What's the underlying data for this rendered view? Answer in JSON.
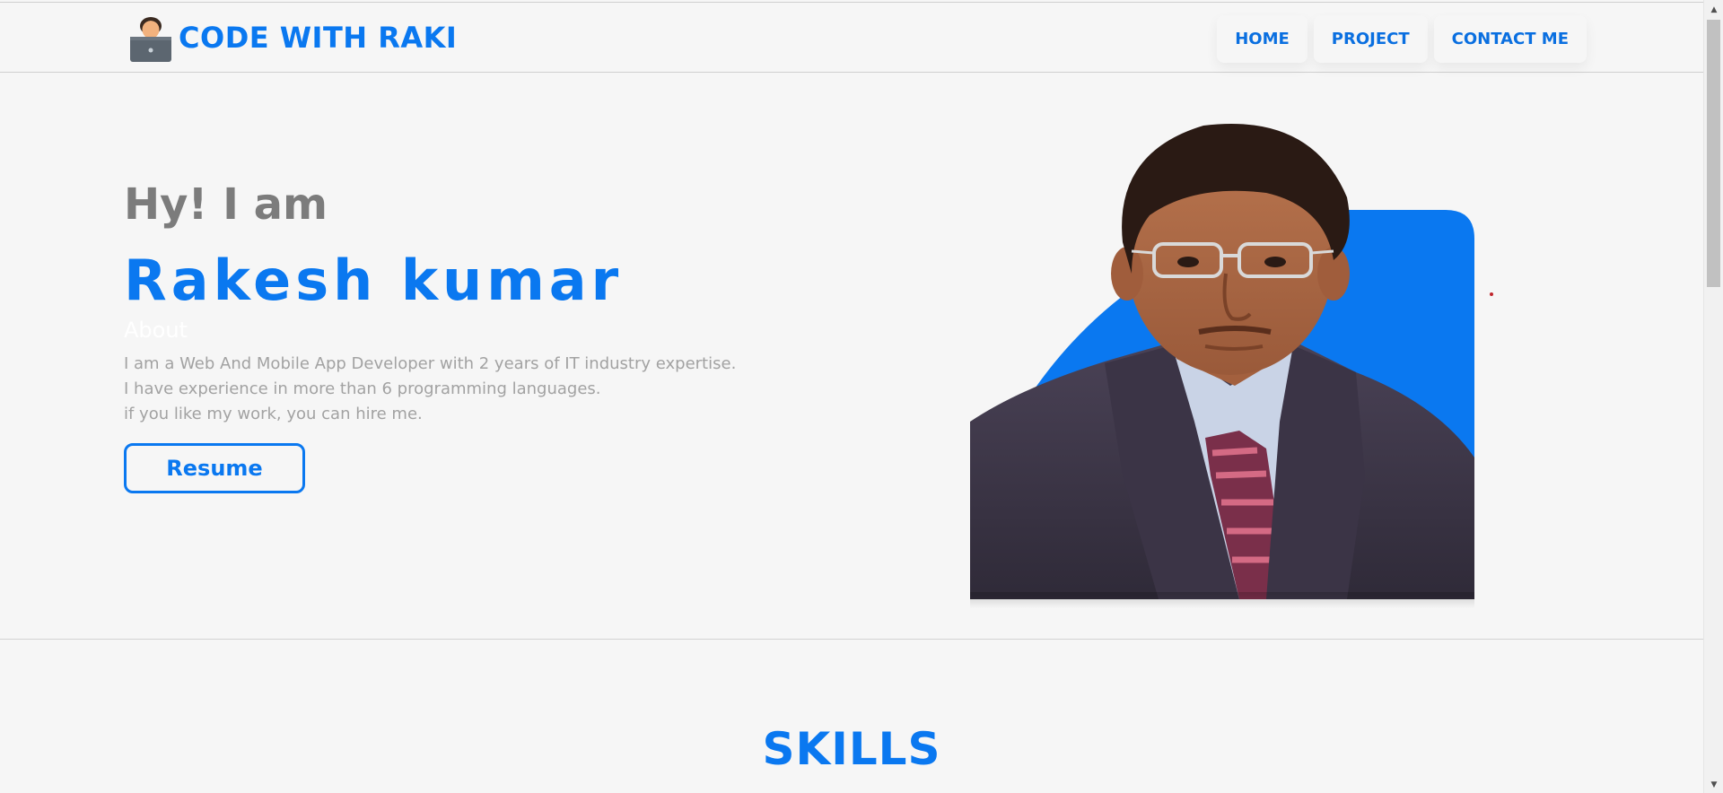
{
  "header": {
    "logo_text": "CODE WITH RAKI",
    "logo_icon": "developer-laptop-icon",
    "nav": [
      {
        "label": "HOME"
      },
      {
        "label": "PROJECT"
      },
      {
        "label": "CONTACT ME"
      }
    ]
  },
  "hero": {
    "greeting": "Hy! I am",
    "name": "Rakesh kumar",
    "about_title": "About",
    "about_lines": [
      "I am a Web And Mobile App Developer with 2 years of IT industry expertise.",
      "I have experience in more than 6 programming languages.",
      "if you like my work, you can hire me."
    ],
    "resume_button": "Resume"
  },
  "skills": {
    "title": "SKILLS"
  },
  "colors": {
    "accent": "#0a78f0",
    "background": "#f6f6f6",
    "greeting": "#7c7c7c",
    "body_text": "#a2a2a2"
  }
}
